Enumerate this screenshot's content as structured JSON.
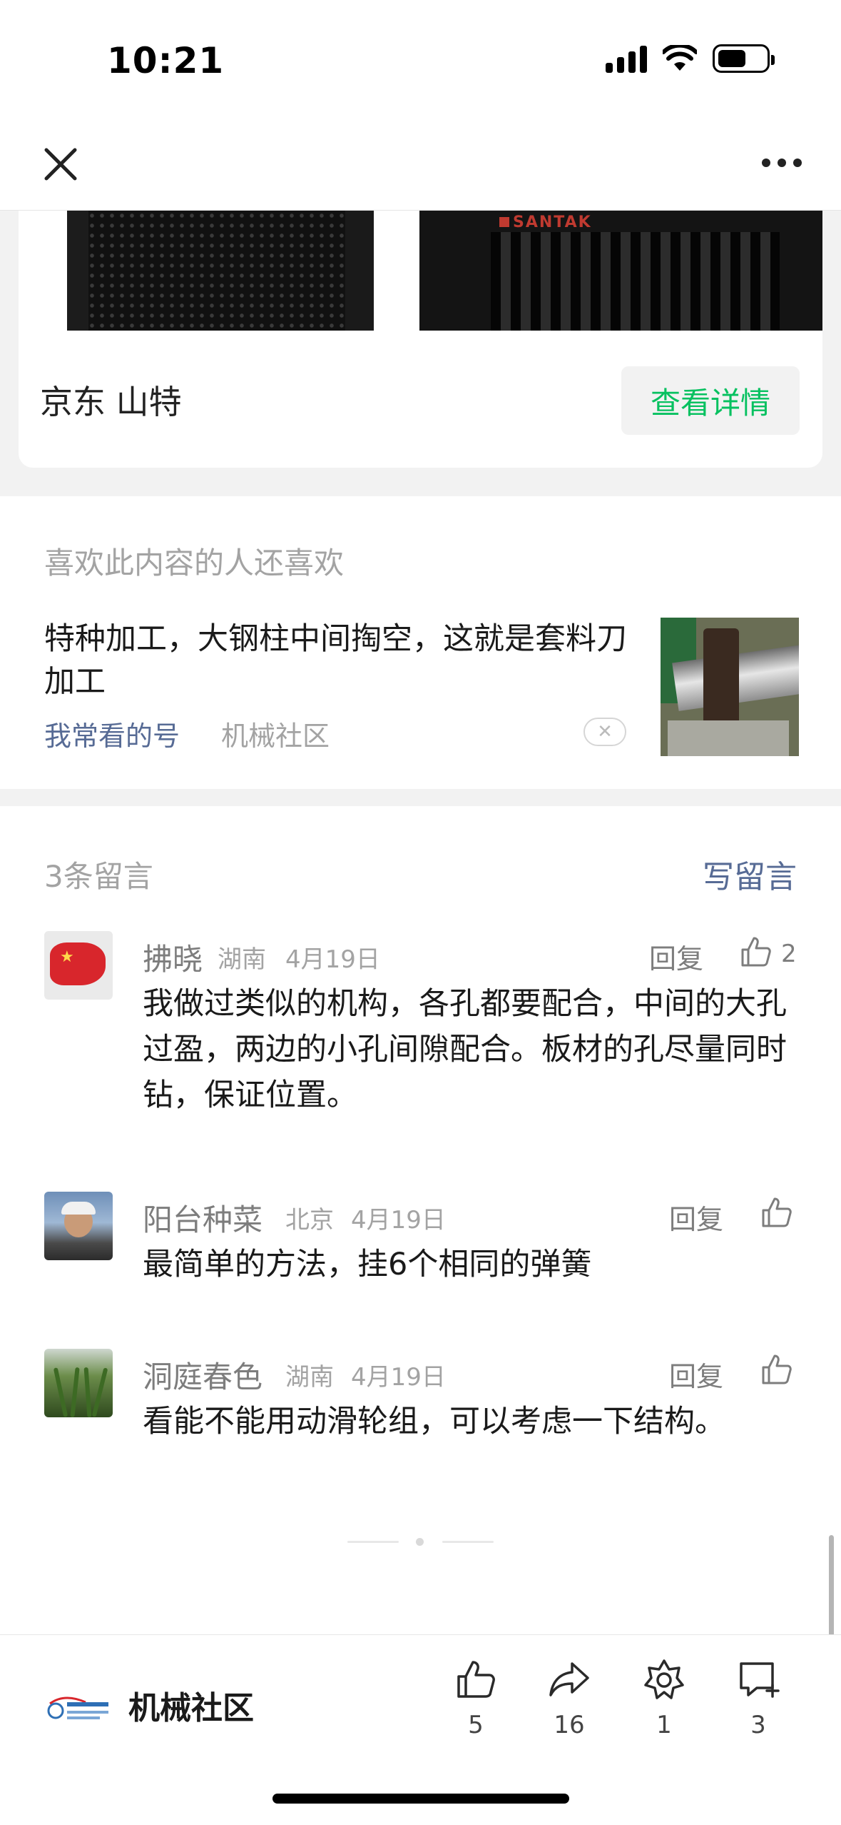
{
  "status_bar": {
    "time": "10:21"
  },
  "nav": {
    "close_icon": "close-icon",
    "more_icon": "more-icon"
  },
  "ad": {
    "logo_text": "SANTAK",
    "brand": "京东 山特",
    "button_label": "查看详情",
    "accent_color": "#07c160"
  },
  "related": {
    "heading": "喜欢此内容的人还喜欢",
    "title": "特种加工，大钢柱中间掏空，这就是套料刀加工",
    "tag": "我常看的号",
    "source": "机械社区",
    "dismiss_glyph": "✕"
  },
  "comments": {
    "count_label": "3条留言",
    "write_label": "写留言",
    "items": [
      {
        "name": "拂晓",
        "location": "湖南",
        "date": "4月19日",
        "reply_label": "回复",
        "likes": "2",
        "text": "我做过类似的机构，各孔都要配合，中间的大孔过盈，两边的小孔间隙配合。板材的孔尽量同时钻，保证位置。"
      },
      {
        "name": "阳台种菜",
        "location": "北京",
        "date": "4月19日",
        "reply_label": "回复",
        "likes": "",
        "text": "最简单的方法，挂6个相同的弹簧"
      },
      {
        "name": "洞庭春色",
        "location": "湖南",
        "date": "4月19日",
        "reply_label": "回复",
        "likes": "",
        "text": "看能不能用动滑轮组，可以考虑一下结构。"
      }
    ]
  },
  "bottom_bar": {
    "account_name": "机械社区",
    "like_count": "5",
    "share_count": "16",
    "wow_count": "1",
    "comment_count": "3"
  },
  "colors": {
    "link_blue": "#576b95",
    "muted_gray": "#a3a3a3",
    "divider_gray": "#f2f2f2"
  }
}
